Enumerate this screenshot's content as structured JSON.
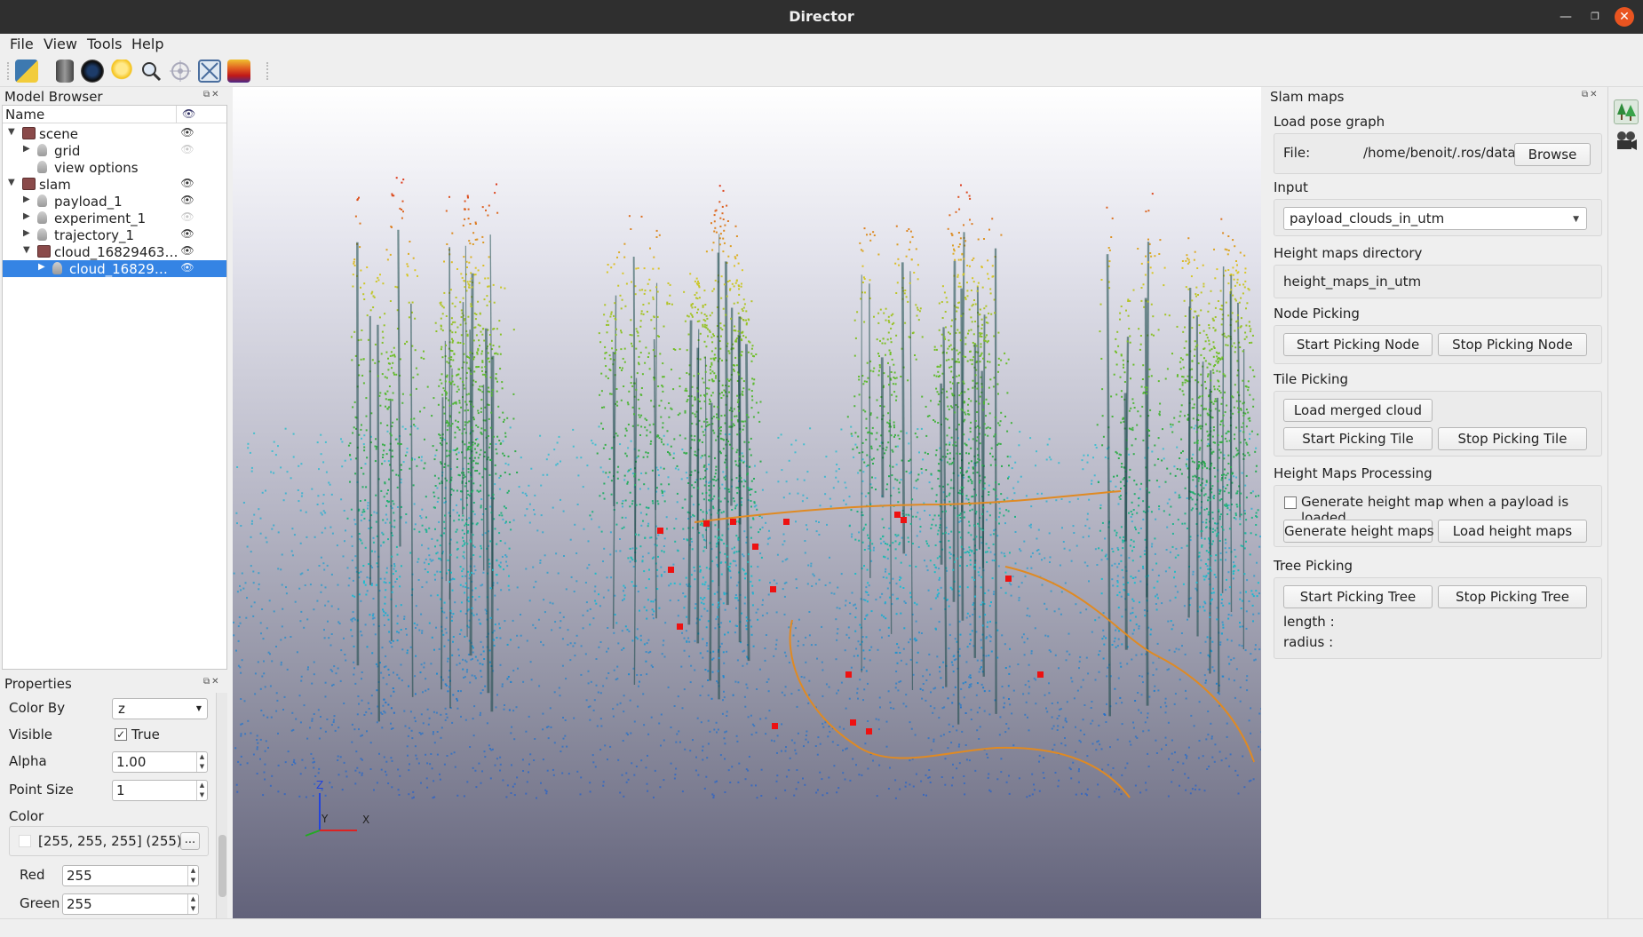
{
  "window": {
    "title": "Director"
  },
  "menu": [
    "File",
    "View",
    "Tools",
    "Help"
  ],
  "toolbar": {
    "icons": [
      "python-icon",
      "database-icon",
      "camera-lens-icon",
      "lightbulb-icon",
      "magnifier-icon",
      "target-icon",
      "fit-view-icon",
      "color-map-icon"
    ]
  },
  "model_browser": {
    "title": "Model Browser",
    "column_name": "Name",
    "items": [
      {
        "label": "scene",
        "level": 0,
        "expanded": true,
        "kind": "folder",
        "visible": true
      },
      {
        "label": "grid",
        "level": 1,
        "expanded": false,
        "kind": "object",
        "visible": false
      },
      {
        "label": "view options",
        "level": 1,
        "kind": "object",
        "visible": null
      },
      {
        "label": "slam",
        "level": 0,
        "expanded": true,
        "kind": "folder",
        "visible": true
      },
      {
        "label": "payload_1",
        "level": 1,
        "expanded": false,
        "kind": "object",
        "visible": true
      },
      {
        "label": "experiment_1",
        "level": 1,
        "expanded": false,
        "kind": "object",
        "visible": false
      },
      {
        "label": "trajectory_1",
        "level": 1,
        "expanded": false,
        "kind": "object",
        "visible": true
      },
      {
        "label": "cloud_16829463…",
        "level": 1,
        "expanded": true,
        "kind": "folder",
        "visible": true
      },
      {
        "label": "cloud_16829…",
        "level": 2,
        "expanded": false,
        "kind": "object",
        "visible": true,
        "selected": true
      }
    ]
  },
  "properties": {
    "title": "Properties",
    "color_by_label": "Color By",
    "color_by_value": "z",
    "visible_label": "Visible",
    "visible_value": "True",
    "alpha_label": "Alpha",
    "alpha_value": "1.00",
    "point_size_label": "Point Size",
    "point_size_value": "1",
    "color_label": "Color",
    "color_value": "[255, 255, 255] (255)",
    "color_button": "...",
    "red_label": "Red",
    "red_value": "255",
    "green_label": "Green",
    "green_value": "255"
  },
  "axes": {
    "x": "X",
    "y": "Y",
    "z": "Z"
  },
  "slam_maps": {
    "title": "Slam maps",
    "load_pose_graph_label": "Load pose graph",
    "file_label": "File:",
    "file_path": "/home/benoit/.ros/data",
    "browse_button": "Browse",
    "input_label": "Input",
    "input_value": "payload_clouds_in_utm",
    "height_maps_dir_label": "Height maps directory",
    "height_maps_dir_value": "height_maps_in_utm",
    "node_picking_label": "Node Picking",
    "start_picking_node": "Start Picking Node",
    "stop_picking_node": "Stop Picking Node",
    "tile_picking_label": "Tile Picking",
    "load_merged_cloud": "Load merged cloud",
    "start_picking_tile": "Start Picking Tile",
    "stop_picking_tile": "Stop Picking Tile",
    "height_maps_processing_label": "Height Maps Processing",
    "generate_on_load_label": "Generate height map when a payload is loaded",
    "generate_height_maps": "Generate height maps",
    "load_height_maps": "Load height maps",
    "tree_picking_label": "Tree Picking",
    "start_picking_tree": "Start Picking Tree",
    "stop_picking_tree": "Stop Picking Tree",
    "length_label": "length :",
    "radius_label": "radius :"
  },
  "side_toolbar": {
    "icons": [
      "forest-icon",
      "movie-camera-icon"
    ]
  }
}
